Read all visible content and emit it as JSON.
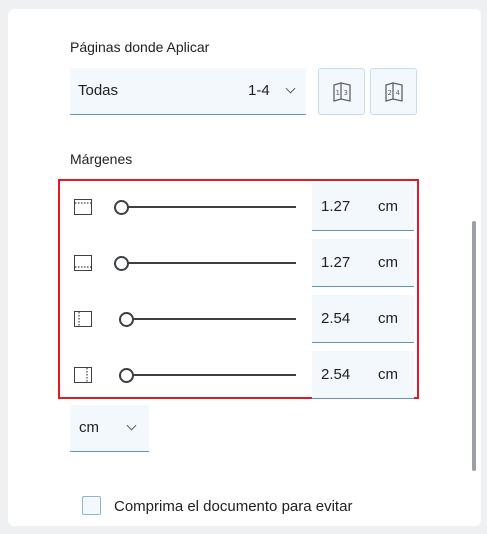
{
  "pages": {
    "label": "Páginas donde Aplicar",
    "selected": "Todas",
    "range": "1-4",
    "icon_buttons": [
      "odd-pages-icon",
      "even-pages-icon"
    ]
  },
  "margins": {
    "label": "Márgenes",
    "rows": [
      {
        "name": "top",
        "icon": "top-margin-icon",
        "value": "1.27",
        "unit": "cm",
        "slider_level": 0.0
      },
      {
        "name": "bottom",
        "icon": "bottom-margin-icon",
        "value": "1.27",
        "unit": "cm",
        "slider_level": 0.0
      },
      {
        "name": "left",
        "icon": "left-margin-icon",
        "value": "2.54",
        "unit": "cm",
        "slider_level": 0.03
      },
      {
        "name": "right",
        "icon": "right-margin-icon",
        "value": "2.54",
        "unit": "cm",
        "slider_level": 0.03
      }
    ],
    "highlight_color": "#e01b24"
  },
  "units": {
    "selected": "cm"
  },
  "compress": {
    "label": "Comprima el documento para evitar",
    "checked": false
  },
  "colors": {
    "accent": "#5c95c5",
    "field_background": "#f3f8fc"
  }
}
